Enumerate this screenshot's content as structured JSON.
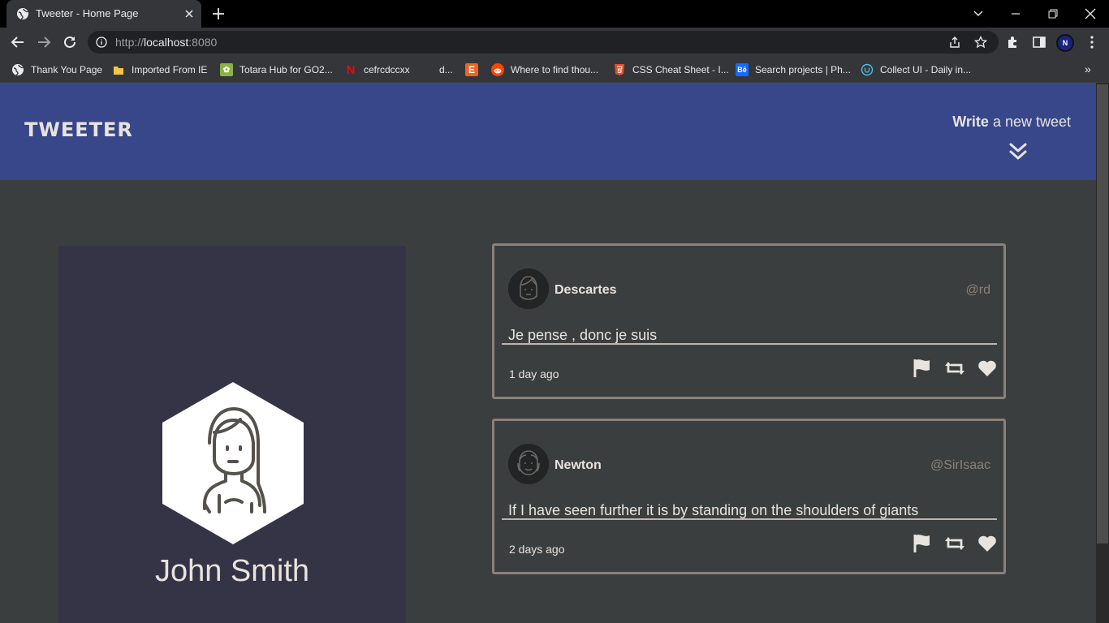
{
  "browser": {
    "tab_title": "Tweeter - Home Page",
    "url_scheme": "http://",
    "url_host": "localhost",
    "url_port": ":8080",
    "profile_initial": "N",
    "bookmarks": [
      {
        "label": "Thank You Page",
        "icon": "globe-icon"
      },
      {
        "label": "Imported From IE",
        "icon": "folder-icon"
      },
      {
        "label": "Totara Hub for GO2...",
        "icon": "totara-icon"
      },
      {
        "label": "cefrcdccxx",
        "icon": "netflix-icon"
      },
      {
        "label": "d...",
        "icon": "blank-icon"
      },
      {
        "label": "",
        "icon": "etsy-icon"
      },
      {
        "label": "Where to find thou...",
        "icon": "reddit-icon"
      },
      {
        "label": "CSS Cheat Sheet - I...",
        "icon": "html5-icon"
      },
      {
        "label": "Search projects | Ph...",
        "icon": "behance-icon"
      },
      {
        "label": "Collect UI - Daily in...",
        "icon": "collectui-icon"
      }
    ],
    "bookmarks_overflow": "»"
  },
  "header": {
    "logo": "TWEETER",
    "compose_bold": "Write",
    "compose_rest": " a new tweet"
  },
  "profile": {
    "name": "John Smith"
  },
  "tweets": [
    {
      "author": "Descartes",
      "handle": "@rd",
      "text": "Je pense , donc je suis",
      "time": "1 day ago"
    },
    {
      "author": "Newton",
      "handle": "@SirIsaac",
      "text": "If I have seen further it is by standing on the shoulders of giants",
      "time": "2 days ago"
    }
  ],
  "colors": {
    "header_bg": "#37478a",
    "page_bg": "#3b3e3f",
    "profile_bg": "#353446",
    "text_light": "#e9e3de",
    "tweet_border": "#8a8178"
  }
}
